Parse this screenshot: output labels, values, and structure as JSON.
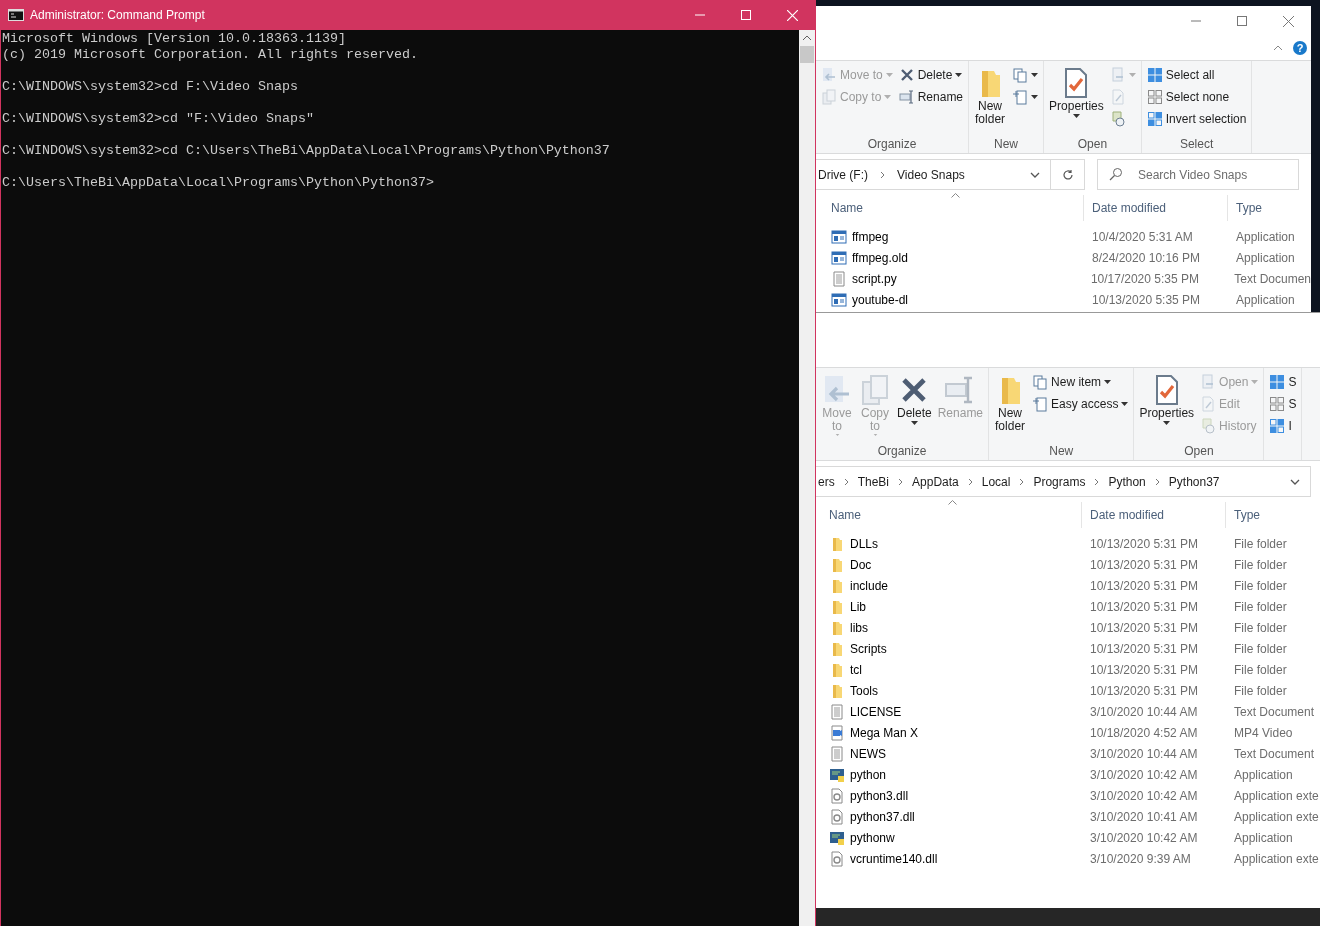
{
  "cmd": {
    "title": "Administrator: Command Prompt",
    "blocks": [
      [
        "Microsoft Windows [Version 10.0.18363.1139]",
        "(c) 2019 Microsoft Corporation. All rights reserved."
      ],
      [
        "C:\\WINDOWS\\system32>cd F:\\Video Snaps"
      ],
      [
        "C:\\WINDOWS\\system32>cd \"F:\\Video Snaps\""
      ],
      [
        "C:\\WINDOWS\\system32>cd C:\\Users\\TheBi\\AppData\\Local\\Programs\\Python\\Python37"
      ],
      [
        "C:\\Users\\TheBi\\AppData\\Local\\Programs\\Python\\Python37>"
      ]
    ]
  },
  "explorer_top": {
    "help": "?",
    "ribbon": [
      {
        "label": "Organize",
        "columns": [
          [
            {
              "kind": "small",
              "label": "Move to",
              "disabled": true,
              "dropdown": true
            },
            {
              "kind": "small",
              "label": "Copy to",
              "disabled": true,
              "dropdown": true
            }
          ],
          [
            {
              "kind": "small",
              "label": "Delete",
              "disabled": false,
              "dropdown": true
            },
            {
              "kind": "small",
              "label": "Rename",
              "disabled": false,
              "dropdown": false
            }
          ]
        ]
      },
      {
        "label": "New",
        "columns": [
          [
            {
              "kind": "large",
              "label": "New folder",
              "disabled": false,
              "dropdown": false
            }
          ],
          [
            {
              "kind": "small",
              "disabled": false,
              "dropdown": true
            },
            {
              "kind": "small",
              "disabled": false,
              "dropdown": true
            }
          ]
        ]
      },
      {
        "label": "Open",
        "columns": [
          [
            {
              "kind": "large",
              "label": "Properties",
              "disabled": false,
              "dropdown": true
            }
          ],
          [
            {
              "kind": "small",
              "disabled": true,
              "dropdown": true
            },
            {
              "kind": "small",
              "disabled": true,
              "dropdown": false
            },
            {
              "kind": "small",
              "disabled": false,
              "dropdown": false
            }
          ]
        ]
      },
      {
        "label": "Select",
        "columns": [
          [
            {
              "kind": "small",
              "label": "Select all",
              "disabled": false,
              "dropdown": false
            },
            {
              "kind": "small",
              "label": "Select none",
              "disabled": false,
              "dropdown": false
            },
            {
              "kind": "small",
              "label": "Invert selection",
              "disabled": false,
              "dropdown": false
            }
          ]
        ]
      }
    ],
    "breadcrumb": [
      "Drive (F:)",
      "Video Snaps"
    ],
    "search": {
      "placeholder": "Search Video Snaps"
    },
    "columns": [
      "Name",
      "Date modified",
      "Type"
    ],
    "rows": [
      {
        "kind": "app",
        "name": "ffmpeg",
        "date": "10/4/2020 5:31 AM",
        "type": "Application"
      },
      {
        "kind": "app",
        "name": "ffmpeg.old",
        "date": "8/24/2020 10:16 PM",
        "type": "Application"
      },
      {
        "kind": "text",
        "name": "script.py",
        "date": "10/17/2020 5:35 PM",
        "type": "Text Documen"
      },
      {
        "kind": "app",
        "name": "youtube-dl",
        "date": "10/13/2020 5:35 PM",
        "type": "Application"
      }
    ]
  },
  "explorer_bottom": {
    "ribbon": [
      {
        "label": "Organize",
        "columns": [
          [
            {
              "kind": "large",
              "label": "Move to",
              "disabled": true,
              "dropdown": true
            }
          ],
          [
            {
              "kind": "large",
              "label": "Copy to",
              "disabled": true,
              "dropdown": true
            }
          ],
          [
            {
              "kind": "large",
              "label": "Delete",
              "disabled": false,
              "dropdown": true
            }
          ],
          [
            {
              "kind": "large",
              "label": "Rename",
              "disabled": true,
              "dropdown": false
            }
          ]
        ]
      },
      {
        "label": "New",
        "columns": [
          [
            {
              "kind": "large",
              "label": "New folder",
              "disabled": false,
              "dropdown": false
            }
          ],
          [
            {
              "kind": "small",
              "label": "New item",
              "disabled": false,
              "dropdown": true
            },
            {
              "kind": "small",
              "label": "Easy access",
              "disabled": false,
              "dropdown": true
            }
          ]
        ]
      },
      {
        "label": "Open",
        "columns": [
          [
            {
              "kind": "large",
              "label": "Properties",
              "disabled": false,
              "dropdown": true
            }
          ],
          [
            {
              "kind": "small",
              "label": "Open",
              "disabled": true,
              "dropdown": true
            },
            {
              "kind": "small",
              "label": "Edit",
              "disabled": true,
              "dropdown": false
            },
            {
              "kind": "small",
              "label": "History",
              "disabled": true,
              "dropdown": false
            }
          ]
        ]
      },
      {
        "columns": [
          [
            {
              "kind": "small",
              "label": "S",
              "disabled": false,
              "dropdown": false
            },
            {
              "kind": "small",
              "label": "S",
              "disabled": false,
              "dropdown": false
            },
            {
              "kind": "small",
              "label": "I",
              "disabled": false,
              "dropdown": false
            }
          ]
        ]
      }
    ],
    "breadcrumb": [
      "ers",
      "TheBi",
      "AppData",
      "Local",
      "Programs",
      "Python",
      "Python37"
    ],
    "columns": [
      "Name",
      "Date modified",
      "Type"
    ],
    "rows": [
      {
        "kind": "folder",
        "name": "DLLs",
        "date": "10/13/2020 5:31 PM",
        "type": "File folder"
      },
      {
        "kind": "folder",
        "name": "Doc",
        "date": "10/13/2020 5:31 PM",
        "type": "File folder"
      },
      {
        "kind": "folder",
        "name": "include",
        "date": "10/13/2020 5:31 PM",
        "type": "File folder"
      },
      {
        "kind": "folder",
        "name": "Lib",
        "date": "10/13/2020 5:31 PM",
        "type": "File folder"
      },
      {
        "kind": "folder",
        "name": "libs",
        "date": "10/13/2020 5:31 PM",
        "type": "File folder"
      },
      {
        "kind": "folder",
        "name": "Scripts",
        "date": "10/13/2020 5:31 PM",
        "type": "File folder"
      },
      {
        "kind": "folder",
        "name": "tcl",
        "date": "10/13/2020 5:31 PM",
        "type": "File folder"
      },
      {
        "kind": "folder",
        "name": "Tools",
        "date": "10/13/2020 5:31 PM",
        "type": "File folder"
      },
      {
        "kind": "text",
        "name": "LICENSE",
        "date": "3/10/2020 10:44 AM",
        "type": "Text Document"
      },
      {
        "kind": "video",
        "name": "Mega Man X",
        "date": "10/18/2020 4:52 AM",
        "type": "MP4 Video"
      },
      {
        "kind": "text",
        "name": "NEWS",
        "date": "3/10/2020 10:44 AM",
        "type": "Text Document"
      },
      {
        "kind": "python",
        "name": "python",
        "date": "3/10/2020 10:42 AM",
        "type": "Application"
      },
      {
        "kind": "dll",
        "name": "python3.dll",
        "date": "3/10/2020 10:42 AM",
        "type": "Application exte"
      },
      {
        "kind": "dll",
        "name": "python37.dll",
        "date": "3/10/2020 10:41 AM",
        "type": "Application exte"
      },
      {
        "kind": "python",
        "name": "pythonw",
        "date": "3/10/2020 10:42 AM",
        "type": "Application"
      },
      {
        "kind": "dll",
        "name": "vcruntime140.dll",
        "date": "3/10/2020 9:39 AM",
        "type": "Application exte"
      }
    ]
  }
}
